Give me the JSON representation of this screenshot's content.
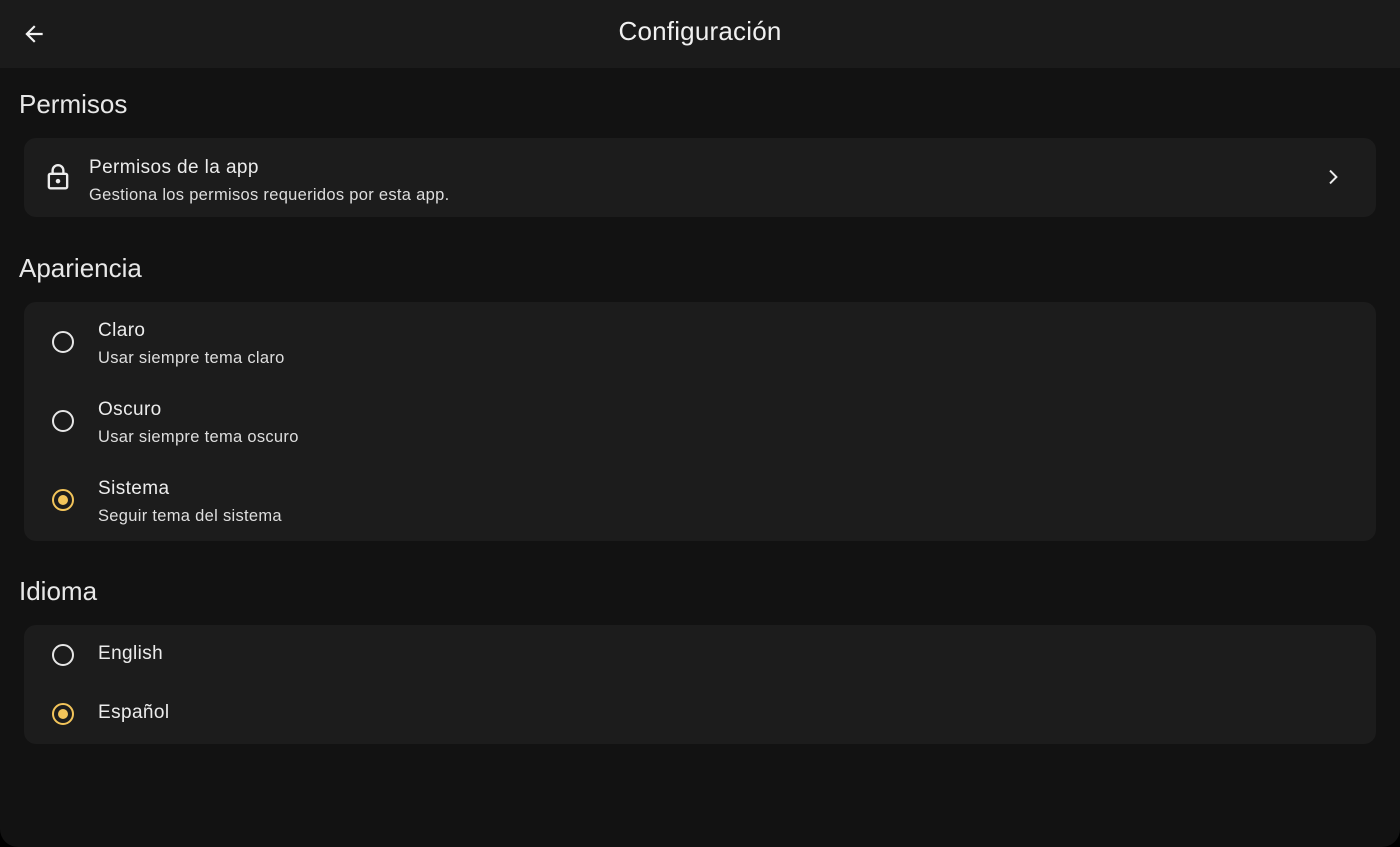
{
  "header": {
    "title": "Configuración"
  },
  "sections": {
    "permissions": {
      "title": "Permisos",
      "item": {
        "title": "Permisos de la app",
        "subtitle": "Gestiona los permisos requeridos por esta app."
      }
    },
    "appearance": {
      "title": "Apariencia",
      "options": [
        {
          "title": "Claro",
          "subtitle": "Usar siempre tema claro",
          "selected": false
        },
        {
          "title": "Oscuro",
          "subtitle": "Usar siempre tema oscuro",
          "selected": false
        },
        {
          "title": "Sistema",
          "subtitle": "Seguir tema del sistema",
          "selected": true
        }
      ]
    },
    "language": {
      "title": "Idioma",
      "options": [
        {
          "title": "English",
          "selected": false
        },
        {
          "title": "Español",
          "selected": true
        }
      ]
    }
  },
  "colors": {
    "accent": "#f2c45a",
    "background": "#121212",
    "surface": "#1c1c1c",
    "app_bar": "#1b1b1b"
  },
  "icons": {
    "back": "arrow-back-icon",
    "permissions": "lock-icon",
    "chevron": "chevron-right-icon"
  }
}
